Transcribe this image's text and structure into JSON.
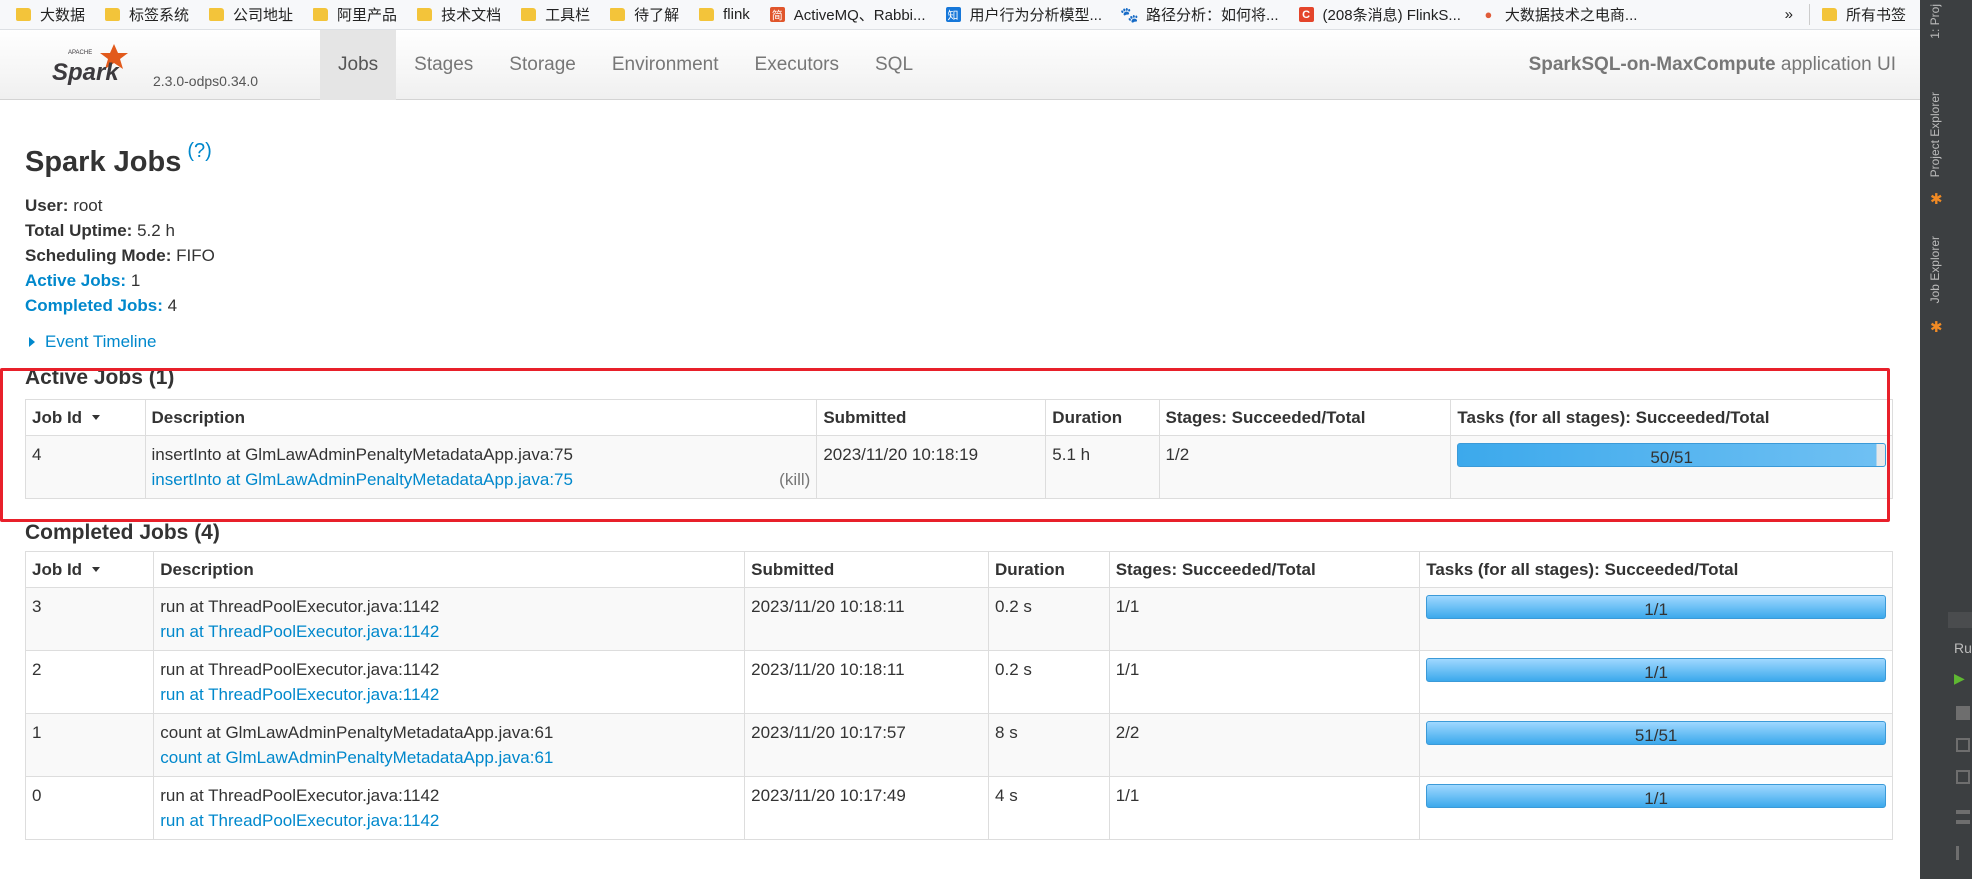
{
  "bookmarks": [
    {
      "icon": "folder-icon",
      "label": "大数据"
    },
    {
      "icon": "folder-icon",
      "label": "标签系统"
    },
    {
      "icon": "folder-icon",
      "label": "公司地址"
    },
    {
      "icon": "folder-icon",
      "label": "阿里产品"
    },
    {
      "icon": "folder-icon",
      "label": "技术文档"
    },
    {
      "icon": "folder-icon",
      "label": "工具栏"
    },
    {
      "icon": "folder-icon",
      "label": "待了解"
    },
    {
      "icon": "folder-icon",
      "label": "flink"
    },
    {
      "icon": "jianshu-icon",
      "label": "ActiveMQ、Rabbi..."
    },
    {
      "icon": "zhihu-icon",
      "label": "用户行为分析模型..."
    },
    {
      "icon": "baidu-paw-icon",
      "label": "路径分析：如何将..."
    },
    {
      "icon": "csdn-icon",
      "label": "(208条消息) FlinkS..."
    },
    {
      "icon": "pin-icon",
      "label": "大数据技术之电商..."
    }
  ],
  "bookmarks_more": "»",
  "bookmarks_all": "所有书签",
  "navbar": {
    "version": "2.3.0-odps0.34.0",
    "tabs": [
      "Jobs",
      "Stages",
      "Storage",
      "Environment",
      "Executors",
      "SQL"
    ],
    "app_name_bold": "SparkSQL-on-MaxCompute",
    "app_name_suffix": " application UI"
  },
  "ide": {
    "tab1": "1: Proj",
    "tab2": "Project Explorer",
    "tab3": "Job Explorer",
    "run": "Ru"
  },
  "page": {
    "title": "Spark Jobs",
    "help": "(?)",
    "summary": {
      "user_label": "User:",
      "user": " root",
      "uptime_label": "Total Uptime:",
      "uptime": " 5.2 h",
      "mode_label": "Scheduling Mode:",
      "mode": " FIFO",
      "active_label": "Active Jobs:",
      "active": " 1",
      "completed_label": "Completed Jobs:",
      "completed": " 4"
    },
    "event_timeline": "Event Timeline"
  },
  "active_jobs": {
    "title": "Active Jobs (1)",
    "headers": [
      "Job Id",
      "Description",
      "Submitted",
      "Duration",
      "Stages: Succeeded/Total",
      "Tasks (for all stages): Succeeded/Total"
    ],
    "rows": [
      {
        "id": "4",
        "desc": "insertInto at GlmLawAdminPenaltyMetadataApp.java:75",
        "link": "insertInto at GlmLawAdminPenaltyMetadataApp.java:75",
        "kill": "(kill)",
        "submitted": "2023/11/20 10:18:19",
        "duration": "5.1 h",
        "stages": "1/2",
        "tasks": "50/51",
        "tasks_fraction": 0.98
      }
    ]
  },
  "completed_jobs": {
    "title": "Completed Jobs (4)",
    "headers": [
      "Job Id",
      "Description",
      "Submitted",
      "Duration",
      "Stages: Succeeded/Total",
      "Tasks (for all stages): Succeeded/Total"
    ],
    "rows": [
      {
        "id": "3",
        "desc": "run at ThreadPoolExecutor.java:1142",
        "link": "run at ThreadPoolExecutor.java:1142",
        "submitted": "2023/11/20 10:18:11",
        "duration": "0.2 s",
        "stages": "1/1",
        "tasks": "1/1"
      },
      {
        "id": "2",
        "desc": "run at ThreadPoolExecutor.java:1142",
        "link": "run at ThreadPoolExecutor.java:1142",
        "submitted": "2023/11/20 10:18:11",
        "duration": "0.2 s",
        "stages": "1/1",
        "tasks": "1/1"
      },
      {
        "id": "1",
        "desc": "count at GlmLawAdminPenaltyMetadataApp.java:61",
        "link": "count at GlmLawAdminPenaltyMetadataApp.java:61",
        "submitted": "2023/11/20 10:17:57",
        "duration": "8 s",
        "stages": "2/2",
        "tasks": "51/51"
      },
      {
        "id": "0",
        "desc": "run at ThreadPoolExecutor.java:1142",
        "link": "run at ThreadPoolExecutor.java:1142",
        "submitted": "2023/11/20 10:17:49",
        "duration": "4 s",
        "stages": "1/1",
        "tasks": "1/1"
      }
    ]
  },
  "colors": {
    "link": "#0088cc",
    "progress": "#3ca9ec",
    "highlight_box": "#e8202a",
    "spark_orange": "#e25a1c"
  }
}
